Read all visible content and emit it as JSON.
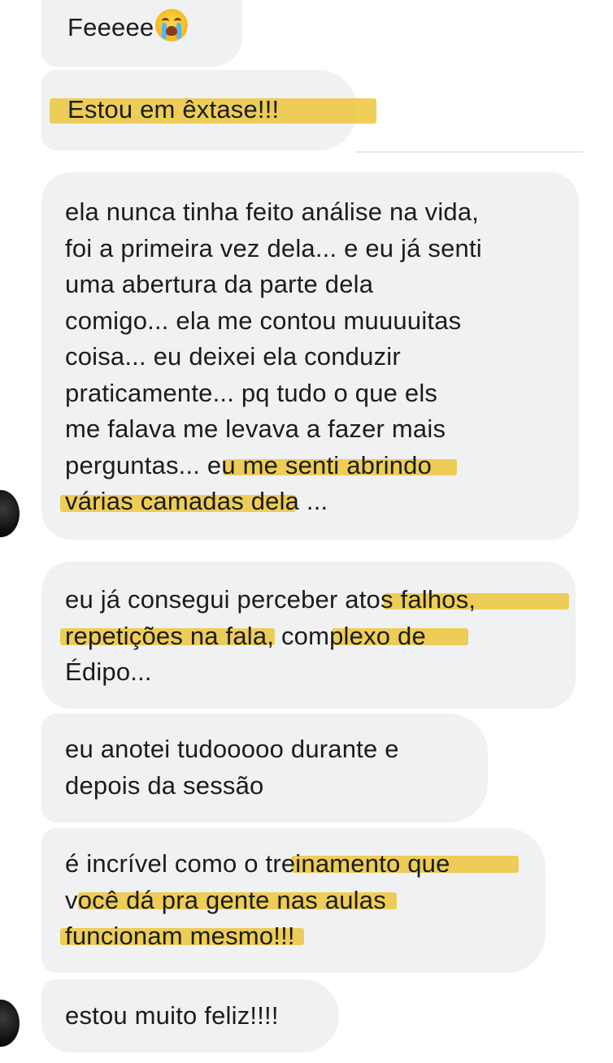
{
  "messages": [
    {
      "lines": [
        {
          "text": "Feeeee",
          "emoji": "loudly-crying-face-emoji"
        }
      ]
    },
    {
      "lines": [
        {
          "text": "Estou em êxtase!!!"
        }
      ]
    },
    {
      "lines": [
        {
          "text": "ela nunca tinha feito análise na vida,"
        },
        {
          "text": "foi a primeira vez dela... e eu já senti"
        },
        {
          "text": "uma abertura da parte dela"
        },
        {
          "text": "comigo... ela me contou muuuuitas"
        },
        {
          "text": "coisa... eu deixei ela conduzir"
        },
        {
          "text": "praticamente... pq tudo o que els"
        },
        {
          "text": "me falava me levava a fazer mais"
        },
        {
          "text": "perguntas... eu me senti abrindo"
        },
        {
          "text": "várias camadas dela ..."
        }
      ]
    },
    {
      "lines": [
        {
          "text": "eu já consegui perceber atos falhos,"
        },
        {
          "text": "repetições na fala, complexo de"
        },
        {
          "text": "Édipo..."
        }
      ]
    },
    {
      "lines": [
        {
          "text": "eu anotei tudooooo durante e"
        },
        {
          "text": "depois da sessão"
        }
      ]
    },
    {
      "lines": [
        {
          "text": "é incrível como o treinamento que"
        },
        {
          "text": "você dá pra gente nas aulas"
        },
        {
          "text": "funcionam mesmo!!!"
        }
      ]
    },
    {
      "lines": [
        {
          "text": "estou muito feliz!!!!"
        }
      ]
    }
  ],
  "highlight_color": "#ECC434",
  "bubble_color": "#F0F1F3"
}
